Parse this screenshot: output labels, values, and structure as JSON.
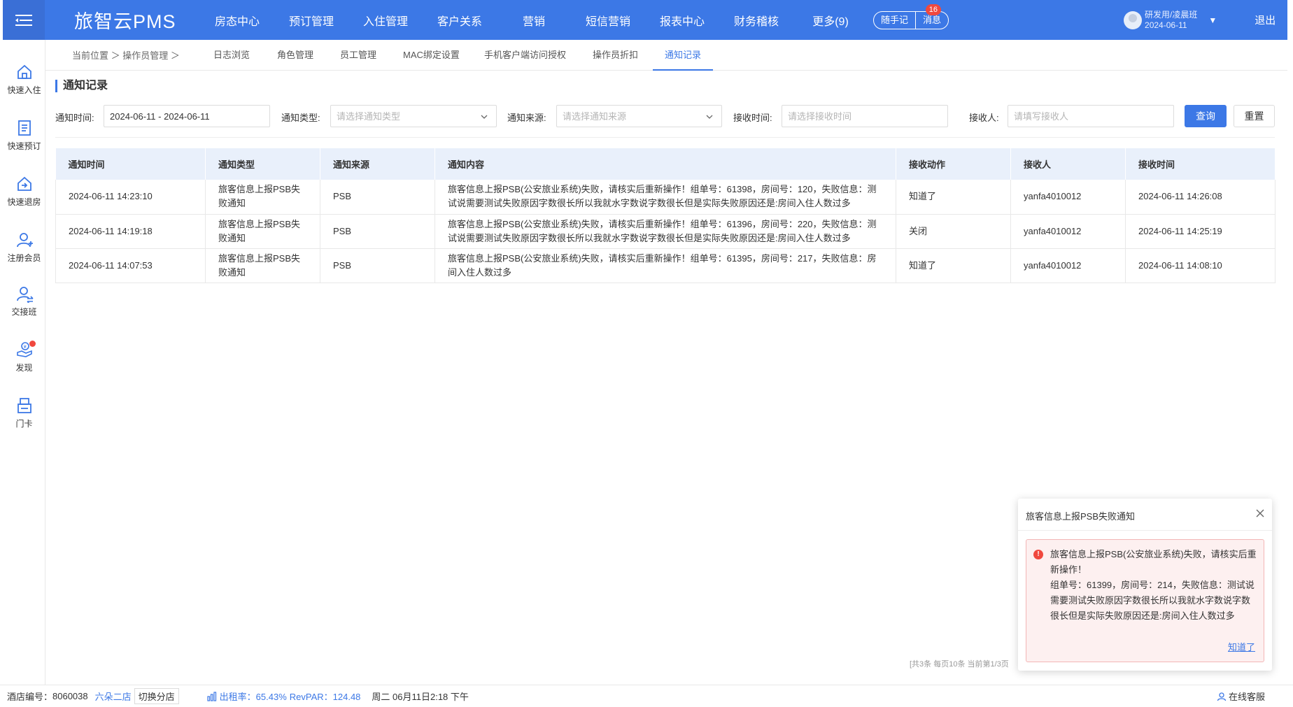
{
  "header": {
    "brand": "旅智云PMS",
    "nav": [
      "房态中心",
      "预订管理",
      "入住管理",
      "客户关系",
      "营销",
      "短信营销",
      "报表中心",
      "财务稽核",
      "更多(9)"
    ],
    "notes_label": "随手记",
    "messages_label": "消息",
    "messages_badge": "16",
    "user_name": "研发用/凌晨班",
    "user_date": "2024-06-11",
    "logout": "退出"
  },
  "sidebar": {
    "items": [
      {
        "label": "快速入住",
        "icon": "home-icon"
      },
      {
        "label": "快速预订",
        "icon": "booking-icon"
      },
      {
        "label": "快速退房",
        "icon": "checkout-icon"
      },
      {
        "label": "注册会员",
        "icon": "member-icon"
      },
      {
        "label": "交接班",
        "icon": "shift-icon"
      },
      {
        "label": "发现",
        "icon": "discover-icon"
      },
      {
        "label": "门卡",
        "icon": "card-icon"
      }
    ]
  },
  "subnav": {
    "crumb": "当前位置 ＞ 操作员管理 ＞",
    "tabs": [
      "日志浏览",
      "角色管理",
      "员工管理",
      "MAC绑定设置",
      "手机客户端访问授权",
      "操作员折扣",
      "通知记录"
    ],
    "active_tab": "通知记录"
  },
  "page_title": "通知记录",
  "filters": {
    "time_label": "通知时间:",
    "time_value": "2024-06-11 - 2024-06-11",
    "type_label": "通知类型:",
    "type_placeholder": "请选择通知类型",
    "source_label": "通知来源:",
    "source_placeholder": "请选择通知来源",
    "receive_time_label": "接收时间:",
    "receive_time_placeholder": "请选择接收时间",
    "receiver_label": "接收人:",
    "receiver_placeholder": "请填写接收人",
    "query": "查询",
    "reset": "重置"
  },
  "table": {
    "headers": [
      "通知时间",
      "通知类型",
      "通知来源",
      "通知内容",
      "接收动作",
      "接收人",
      "接收时间"
    ],
    "rows": [
      [
        "2024-06-11 14:23:10",
        "旅客信息上报PSB失败通知",
        "PSB",
        "旅客信息上报PSB(公安旅业系统)失败，请核实后重新操作！组单号：61398，房间号：120，失败信息：测试说需要测试失败原因字数很长所以我就水字数说字数很长但是实际失败原因还是:房间入住人数过多",
        "知道了",
        "yanfa4010012",
        "2024-06-11 14:26:08"
      ],
      [
        "2024-06-11 14:19:18",
        "旅客信息上报PSB失败通知",
        "PSB",
        "旅客信息上报PSB(公安旅业系统)失败，请核实后重新操作！组单号：61396，房间号：220，失败信息：测试说需要测试失败原因字数很长所以我就水字数说字数很长但是实际失败原因还是:房间入住人数过多",
        "关闭",
        "yanfa4010012",
        "2024-06-11 14:25:19"
      ],
      [
        "2024-06-11 14:07:53",
        "旅客信息上报PSB失败通知",
        "PSB",
        "旅客信息上报PSB(公安旅业系统)失败，请核实后重新操作！组单号：61395，房间号：217，失败信息：房间入住人数过多",
        "知道了",
        "yanfa4010012",
        "2024-06-11 14:08:10"
      ]
    ]
  },
  "pager": "[共3条 每页10条 当前第1/3页",
  "footer": {
    "hotel_no_label": "酒店编号：",
    "hotel_no": "8060038",
    "hotel_name": "六朵二店",
    "switch_store": "切换分店",
    "occupancy": "出租率：65.43%",
    "revpar": "RevPAR：124.48",
    "datetime": "周二 06月11日2:18 下午",
    "support": "在线客服"
  },
  "notification": {
    "title": "旅客信息上报PSB失败通知",
    "message_line1": "旅客信息上报PSB(公安旅业系统)失败，请核实后重新操作！",
    "message_line2": "组单号：61399，房间号：214，失败信息：测试说需要测试失败原因字数很长所以我就水字数说字数很长但是实际失败原因还是:房间入住人数过多",
    "action": "知道了"
  },
  "colors": {
    "primary": "#3c78e6",
    "header_bg": "#3c78e6",
    "badge": "#f0483e",
    "table_header_bg": "#e9f0fb",
    "error_bg": "#fdf0f0"
  }
}
